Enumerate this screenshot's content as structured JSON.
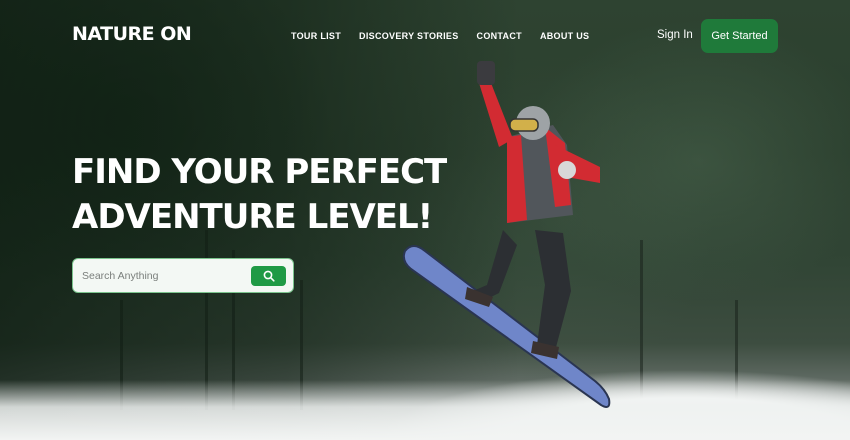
{
  "brand": {
    "logo": "NATURE ON"
  },
  "nav": {
    "links": [
      {
        "label": "TOUR LIST"
      },
      {
        "label": "DISCOVERY STORIES"
      },
      {
        "label": "CONTACT"
      },
      {
        "label": "ABOUT US"
      }
    ],
    "sign_in": "Sign In",
    "get_started": "Get Started"
  },
  "hero": {
    "headline_line1": "FIND YOUR PERFECT",
    "headline_line2": "ADVENTURE LEVEL!"
  },
  "search": {
    "placeholder": "Search Anything",
    "value": ""
  },
  "colors": {
    "accent_green": "#1f7a3a",
    "search_button_green": "#1f9a45",
    "jacket_red": "#d22b32",
    "board_blue": "#6f86c9"
  },
  "icons": {
    "search_button": "search-icon"
  }
}
